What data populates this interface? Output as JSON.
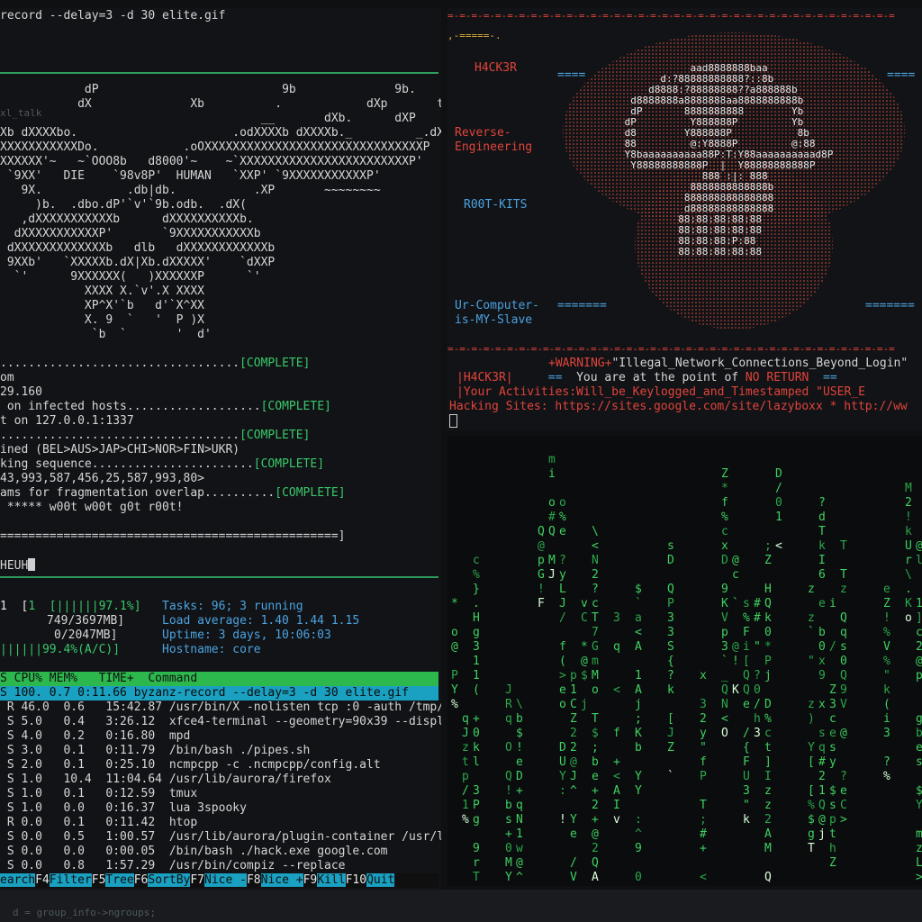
{
  "left": {
    "title_line": "record --delay=3 -d 30 elite.gif",
    "art": [
      "            dP                          9b              9b.    .",
      "           dX              Xb          .            dXp       t",
      "                                     __       dXb.      dXP      .Xb",
      "Xb dXXXXbo.                      .odXXXXb dXXXXb._         _.dXXP",
      "XXXXXXXXXXXDo.            .oOXXXXXXXXXXXXXXXXXXXXXXXXXXXXXXXP",
      "XXXXXX'~   ~`OOO8b   d8000'~    ~`XXXXXXXXXXXXXXXXXXXXXXXXP'",
      " `9XX'   DIE    `98v8P'  HUMAN   `XXP' `9XXXXXXXXXXXP'",
      "   9X.            .db|db.           .XP       ~~~~~~~~",
      "     )b.  .dbo.dP'`v'`9b.odb.  .dX(",
      "   ,dXXXXXXXXXXXb      dXXXXXXXXXXb.",
      "  dXXXXXXXXXXXP'       `9XXXXXXXXXXXb",
      " dXXXXXXXXXXXXXb   dlb   dXXXXXXXXXXXXb",
      " 9XXb'   `XXXXXb.dX|Xb.dXXXXX'    `dXXP",
      "  `'      9XXXXXX(   )XXXXXXP      `'",
      "            XXXX X.`v'.X XXXX",
      "            XP^X'`b   d'`X^XX",
      "            X. 9  `   '  P )X",
      "             `b  `       '  d'"
    ],
    "status_lines": [
      {
        "text": "..................................",
        "status": "[COMPLETE]"
      },
      {
        "text": "om",
        "status": ""
      },
      {
        "text": "29.160",
        "status": ""
      },
      {
        "text": " on infected hosts...................",
        "status": "[COMPLETE]"
      },
      {
        "text": "t on 127.0.0.1:1337",
        "status": ""
      },
      {
        "text": "..................................",
        "status": "[COMPLETE]"
      },
      {
        "text": "ined (BEL>AUS>JAP>CHI>NOR>FIN>UKR)",
        "status": ""
      },
      {
        "text": "king sequence.......................",
        "status": "[COMPLETE]"
      },
      {
        "text": "43,993,587,456,25,587,993,80>",
        "status": ""
      },
      {
        "text": "ams for fragmentation overlap..........",
        "status": "[COMPLETE]"
      },
      {
        "text": " ***** w00t w00t g0t r00t!",
        "status": ""
      },
      {
        "text": "",
        "status": ""
      },
      {
        "text": "================================================]",
        "status": ""
      },
      {
        "text": "",
        "status": ""
      },
      {
        "text": "HEUH",
        "status": ""
      }
    ],
    "htop": {
      "cpu_line": "1  [||||||97.1%]",
      "mem_line": "749/3697MB]",
      "swp_line": "0/2047MB]",
      "batt_line": "||||||99.4%(A/C)]",
      "tasks": "Tasks: 96; 3 running",
      "load": "Load average: 1.40 1.44 1.15",
      "uptime": "Uptime: 3 days, 10:06:03",
      "hostname": "Hostname: core",
      "header": "S CPU% MEM%   TIME+  Command",
      "rows": [
        {
          "s": "S",
          "cpu": "100.",
          "mem": "0.7",
          "time": "0:11.66",
          "cmd": "byzanz-record --delay=3 -d 30 elite.gif"
        },
        {
          "s": "R",
          "cpu": "46.0",
          "mem": "0.6",
          "time": "15:42.87",
          "cmd": "/usr/bin/X -nolisten tcp :0 -auth /tmp/"
        },
        {
          "s": "S",
          "cpu": "5.0",
          "mem": "0.4",
          "time": "3:26.12",
          "cmd": "xfce4-terminal --geometry=90x39 --displ"
        },
        {
          "s": "S",
          "cpu": "4.0",
          "mem": "0.2",
          "time": "0:16.80",
          "cmd": "mpd"
        },
        {
          "s": "S",
          "cpu": "3.0",
          "mem": "0.1",
          "time": "0:11.79",
          "cmd": "/bin/bash ./pipes.sh"
        },
        {
          "s": "S",
          "cpu": "2.0",
          "mem": "0.1",
          "time": "0:25.10",
          "cmd": "ncmpcpp -c .ncmpcpp/config.alt"
        },
        {
          "s": "S",
          "cpu": "1.0",
          "mem": "10.4",
          "time": "11:04.64",
          "cmd": "/usr/lib/aurora/firefox"
        },
        {
          "s": "S",
          "cpu": "1.0",
          "mem": "0.1",
          "time": "0:12.59",
          "cmd": "tmux"
        },
        {
          "s": "S",
          "cpu": "1.0",
          "mem": "0.0",
          "time": "0:16.37",
          "cmd": "lua 3spooky"
        },
        {
          "s": "R",
          "cpu": "0.0",
          "mem": "0.1",
          "time": "0:11.42",
          "cmd": "htop"
        },
        {
          "s": "S",
          "cpu": "0.0",
          "mem": "0.5",
          "time": "1:00.57",
          "cmd": "/usr/lib/aurora/plugin-container /usr/l"
        },
        {
          "s": "S",
          "cpu": "0.0",
          "mem": "0.0",
          "time": "0:00.05",
          "cmd": "/bin/bash ./hack.exe google.com"
        },
        {
          "s": "S",
          "cpu": "0.0",
          "mem": "0.8",
          "time": "1:57.29",
          "cmd": "/usr/bin/compiz --replace"
        }
      ],
      "fkeys": [
        {
          "k": "",
          "l": "earch"
        },
        {
          "k": "F4",
          "l": "Filter"
        },
        {
          "k": "F5",
          "l": "Tree  "
        },
        {
          "k": "F6",
          "l": "SortBy"
        },
        {
          "k": "F7",
          "l": "Nice -"
        },
        {
          "k": "F8",
          "l": "Nice +"
        },
        {
          "k": "F9",
          "l": "Kill  "
        },
        {
          "k": "F10",
          "l": "Quit"
        }
      ]
    }
  },
  "topright": {
    "box1": [
      ".-=====-.",
      "H4CK3R",
      "Reverse-",
      "Engineering"
    ],
    "box2": [
      "R00T-KITS",
      "Ur-Computer-",
      "is-MY-Slave"
    ],
    "warning": "+WARNING+",
    "warning_msg": "\"Illegal_Network_Connections_Beyond_Login\"",
    "tag": "|H4CK3R|",
    "eq": "==",
    "point_pre": "You are at the point of",
    "no_return": "NO RETURN",
    "activities": "|Your Activities:Will_be_Keylogged_and_Timestamped \"USER_E",
    "hacking": "Hacking Sites: https://sites.google.com/site/lazyboxx * http://ww"
  },
  "matrix": {
    "chars": "2ktvH]iMQT0T%:%/\\0j+/P@+%h5?&YyP:3d[$cCVL\"^+`\"_qs3T)A[+zc;r%3:Q<F?gVTyJ&xK;Vrp1J]eCjkb9!QRa$zw>Y%o>!Gm#oee:@X2.lpm7hPp@FQeyYd!6$*i#F:e*zIsto(j<GCS?z/2b\"hZfUOOoaDsq}Qq@ZIJPxoSc(9TQ8Ts{?U)0<(rD!Zf p_NJJqa`Y0;H1<1\"KHxYY%1Un3U/1Y\\F\\\"bxeZx=ck#zxAs1[$iSJ[zQ«<"
  }
}
